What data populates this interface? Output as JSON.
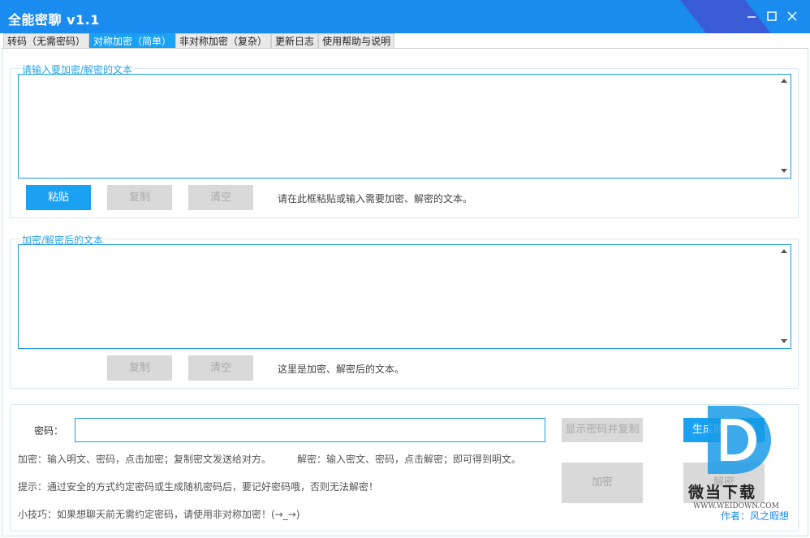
{
  "app": {
    "title": "全能密聊 v1.1",
    "accent": "#1a8cf0",
    "window_buttons": [
      "minimize-icon",
      "maximize-icon",
      "close-icon"
    ]
  },
  "tabs": [
    {
      "label": "转码（无需密码）",
      "active": false
    },
    {
      "label": "对称加密（简单）",
      "active": true
    },
    {
      "label": "非对称加密（复杂）",
      "active": false
    },
    {
      "label": "更新日志",
      "active": false
    },
    {
      "label": "使用帮助与说明",
      "active": false
    }
  ],
  "input_group": {
    "legend": "请输入要加密/解密的文本",
    "value": "",
    "paste_label": "粘贴",
    "copy_label": "复制",
    "clear_label": "清空",
    "hint": "请在此框粘贴或输入需要加密、解密的文本。"
  },
  "output_group": {
    "legend": "加密/解密后的文本",
    "value": "",
    "copy_label": "复制",
    "clear_label": "清空",
    "hint": "这里是加密、解密后的文本。"
  },
  "password": {
    "label": "密码：",
    "value": "",
    "show_copy_label": "显示密码并复制",
    "generate_label": "生成随机密码",
    "encrypt_label": "加密",
    "decrypt_label": "解密"
  },
  "instructions": {
    "encrypt": "加密：输入明文、密码，点击加密；复制密文发送给对方。",
    "decrypt": "解密：输入密文、密码，点击解密；即可得到明文。",
    "tip": "提示：通过安全的方式约定密码或生成随机密码后，要记好密码哦，否则无法解密！",
    "trick": "小技巧：如果想聊天前无需约定密码，请使用非对称加密！(→_→)",
    "author": "作者：风之暇想"
  },
  "watermark": {
    "name": "微当下载",
    "url": "WWW.WEIDOWN.COM",
    "color": "#1a9be6"
  }
}
